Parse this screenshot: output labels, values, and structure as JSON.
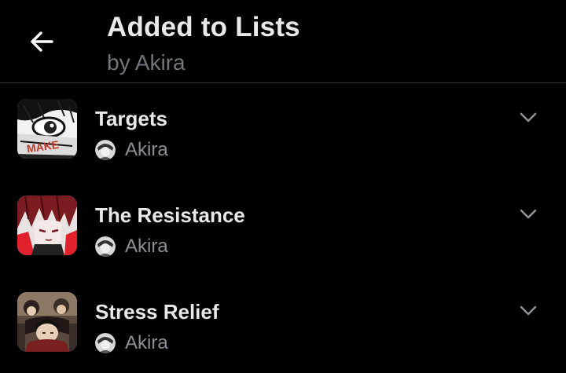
{
  "header": {
    "title": "Added to Lists",
    "subtitle": "by Akira",
    "back_icon": "arrow-left-icon"
  },
  "lists": [
    {
      "name": "Targets",
      "owner": "Akira",
      "thumb_style": "manga-eye",
      "accent": "#c0392b"
    },
    {
      "name": "The Resistance",
      "owner": "Akira",
      "thumb_style": "red-hair-portrait",
      "accent": "#e0202a"
    },
    {
      "name": "Stress Relief",
      "owner": "Akira",
      "thumb_style": "group-portrait",
      "accent": "#8a6a50"
    }
  ],
  "colors": {
    "background": "#000000",
    "primary_text": "#e7e9ea",
    "secondary_text": "#71767b",
    "divider": "#2f3336"
  }
}
